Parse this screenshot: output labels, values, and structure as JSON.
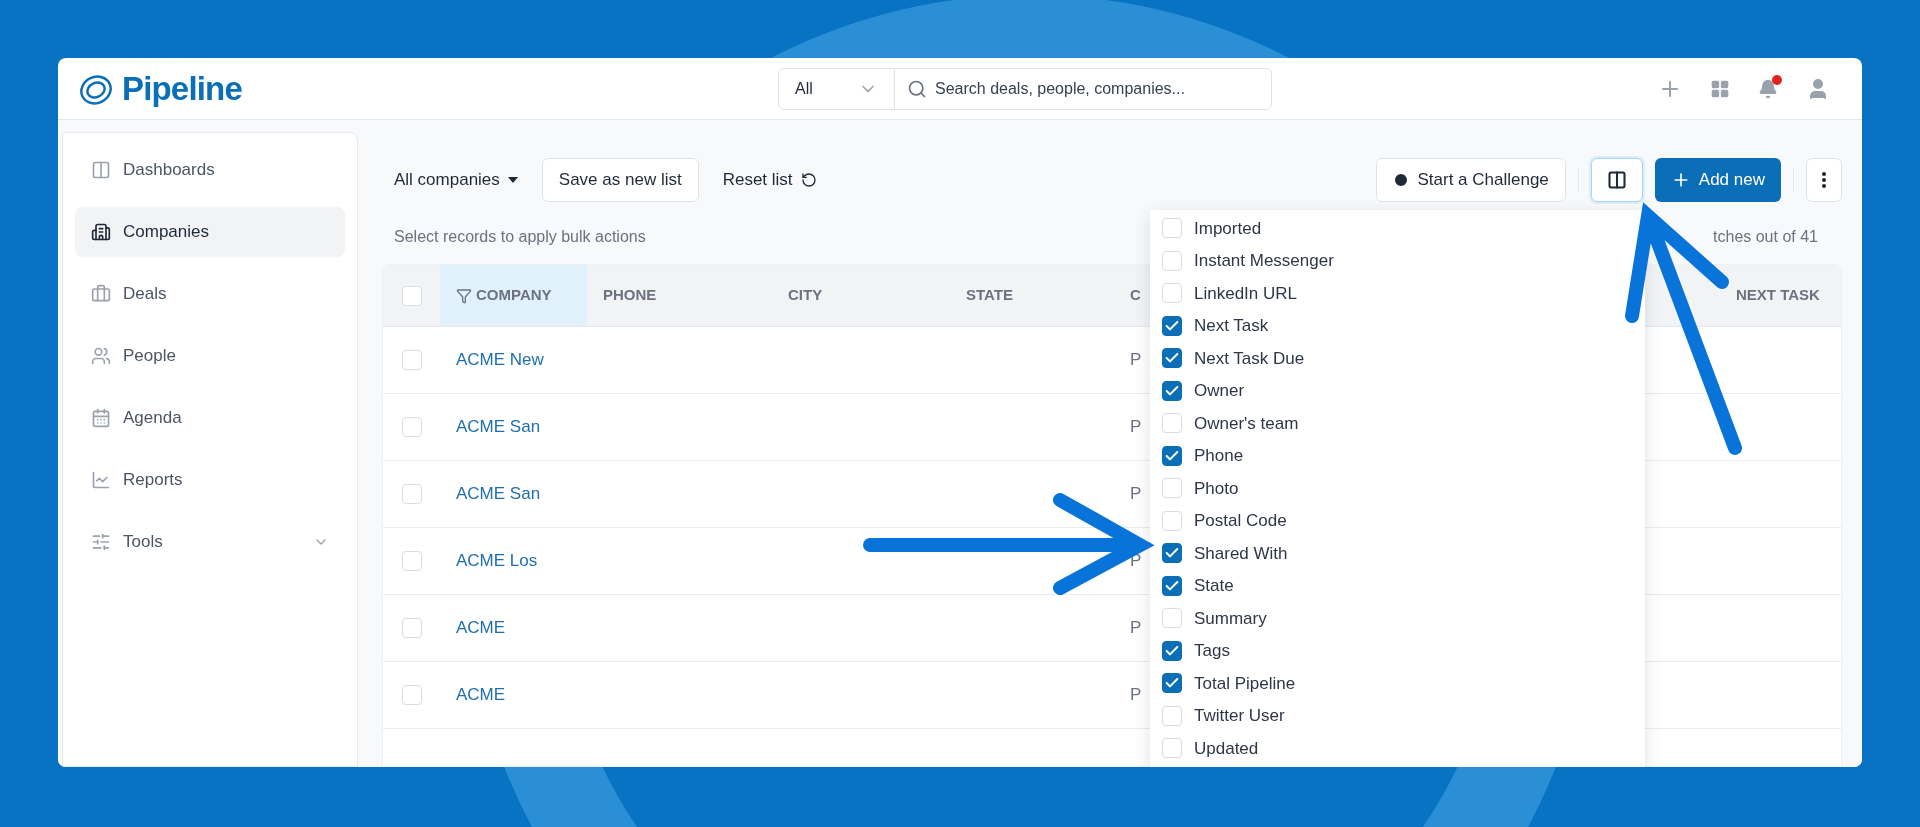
{
  "app": {
    "logo": "Pipeline"
  },
  "search": {
    "scope": "All",
    "placeholder": "Search deals, people, companies..."
  },
  "notifications": {
    "unread": true
  },
  "sidebar": {
    "items": [
      {
        "label": "Dashboards",
        "selected": false,
        "has_submenu": false
      },
      {
        "label": "Companies",
        "selected": true,
        "has_submenu": false
      },
      {
        "label": "Deals",
        "selected": false,
        "has_submenu": false
      },
      {
        "label": "People",
        "selected": false,
        "has_submenu": false
      },
      {
        "label": "Agenda",
        "selected": false,
        "has_submenu": false
      },
      {
        "label": "Reports",
        "selected": false,
        "has_submenu": false
      },
      {
        "label": "Tools",
        "selected": false,
        "has_submenu": true
      }
    ]
  },
  "toolbar": {
    "list_selector": "All companies",
    "save_button": "Save as new list",
    "reset_button": "Reset list",
    "challenge_button": "Start a Challenge",
    "columns_button": {
      "selected": true
    },
    "add_button": "Add new"
  },
  "bulk_hint": "Select records to apply bulk actions",
  "match_count": "tches out of 41",
  "table": {
    "select_all": {
      "checked": false
    },
    "columns": [
      {
        "label": "COMPANY",
        "selected": true
      },
      {
        "label": "PHONE",
        "selected": false
      },
      {
        "label": "CITY",
        "selected": false
      },
      {
        "label": "STATE",
        "selected": false
      },
      {
        "label": "C",
        "selected": false
      },
      {
        "label": "NEXT TASK",
        "selected": false
      }
    ],
    "rows": [
      {
        "checked": false,
        "company": "ACME New",
        "column_5": "P"
      },
      {
        "checked": false,
        "company": "ACME San",
        "column_5": "P"
      },
      {
        "checked": false,
        "company": "ACME San",
        "column_5": "P"
      },
      {
        "checked": false,
        "company": "ACME Los",
        "column_5": "P"
      },
      {
        "checked": false,
        "company": "ACME",
        "column_5": "P"
      },
      {
        "checked": false,
        "company": "ACME",
        "column_5": "P"
      }
    ]
  },
  "column_picker": {
    "items": [
      {
        "label": "Imported",
        "checked": false
      },
      {
        "label": "Instant Messenger",
        "checked": false
      },
      {
        "label": "LinkedIn URL",
        "checked": false
      },
      {
        "label": "Next Task",
        "checked": true
      },
      {
        "label": "Next Task Due",
        "checked": true
      },
      {
        "label": "Owner",
        "checked": true
      },
      {
        "label": "Owner's team",
        "checked": false
      },
      {
        "label": "Phone",
        "checked": true
      },
      {
        "label": "Photo",
        "checked": false
      },
      {
        "label": "Postal Code",
        "checked": false
      },
      {
        "label": "Shared With",
        "checked": true
      },
      {
        "label": "State",
        "checked": true
      },
      {
        "label": "Summary",
        "checked": false
      },
      {
        "label": "Tags",
        "checked": true
      },
      {
        "label": "Total Pipeline",
        "checked": true
      },
      {
        "label": "Twitter User",
        "checked": false
      },
      {
        "label": "Updated",
        "checked": false
      }
    ]
  }
}
